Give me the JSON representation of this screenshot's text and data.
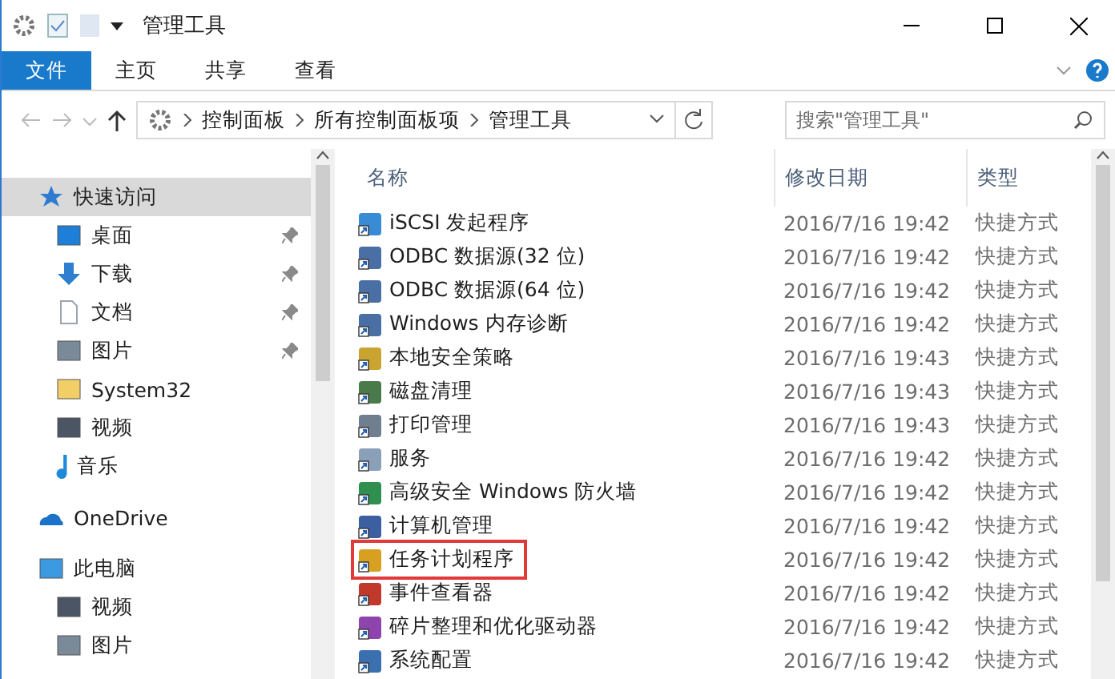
{
  "window": {
    "title": "管理工具"
  },
  "ribbon_tabs": [
    {
      "label": "文件",
      "selected": true
    },
    {
      "label": "主页",
      "selected": false
    },
    {
      "label": "共享",
      "selected": false
    },
    {
      "label": "查看",
      "selected": false
    }
  ],
  "address": {
    "segments": [
      "控制面板",
      "所有控制面板项",
      "管理工具"
    ]
  },
  "search": {
    "placeholder": "搜索\"管理工具\""
  },
  "sidebar": {
    "items": [
      {
        "label": "快速访问",
        "kind": "star",
        "selected": true,
        "pinned": false,
        "children": [
          {
            "label": "桌面",
            "kind": "desktop",
            "selected": false,
            "pinned": true
          },
          {
            "label": "下载",
            "kind": "download",
            "selected": false,
            "pinned": true
          },
          {
            "label": "文档",
            "kind": "document",
            "selected": false,
            "pinned": true
          },
          {
            "label": "图片",
            "kind": "picture",
            "selected": false,
            "pinned": true
          },
          {
            "label": "System32",
            "kind": "folder",
            "selected": false,
            "pinned": false
          },
          {
            "label": "视频",
            "kind": "video",
            "selected": false,
            "pinned": false
          },
          {
            "label": "音乐",
            "kind": "music",
            "selected": false,
            "pinned": false
          }
        ]
      },
      {
        "label": "OneDrive",
        "kind": "cloud",
        "selected": false,
        "pinned": false
      },
      {
        "label": "此电脑",
        "kind": "computer",
        "selected": false,
        "pinned": false,
        "children": [
          {
            "label": "视频",
            "kind": "video",
            "selected": false,
            "pinned": false
          },
          {
            "label": "图片",
            "kind": "picture",
            "selected": false,
            "pinned": false
          }
        ]
      }
    ]
  },
  "table": {
    "columns": [
      "名称",
      "修改日期",
      "类型"
    ],
    "rows": [
      {
        "name": "iSCSI 发起程序",
        "date": "2016/7/16 19:42",
        "type": "快捷方式",
        "highlighted": false
      },
      {
        "name": "ODBC 数据源(32 位)",
        "date": "2016/7/16 19:42",
        "type": "快捷方式",
        "highlighted": false
      },
      {
        "name": "ODBC 数据源(64 位)",
        "date": "2016/7/16 19:42",
        "type": "快捷方式",
        "highlighted": false
      },
      {
        "name": "Windows 内存诊断",
        "date": "2016/7/16 19:42",
        "type": "快捷方式",
        "highlighted": false
      },
      {
        "name": "本地安全策略",
        "date": "2016/7/16 19:43",
        "type": "快捷方式",
        "highlighted": false
      },
      {
        "name": "磁盘清理",
        "date": "2016/7/16 19:43",
        "type": "快捷方式",
        "highlighted": false
      },
      {
        "name": "打印管理",
        "date": "2016/7/16 19:43",
        "type": "快捷方式",
        "highlighted": false
      },
      {
        "name": "服务",
        "date": "2016/7/16 19:42",
        "type": "快捷方式",
        "highlighted": false
      },
      {
        "name": "高级安全 Windows 防火墙",
        "date": "2016/7/16 19:42",
        "type": "快捷方式",
        "highlighted": false
      },
      {
        "name": "计算机管理",
        "date": "2016/7/16 19:42",
        "type": "快捷方式",
        "highlighted": false
      },
      {
        "name": "任务计划程序",
        "date": "2016/7/16 19:42",
        "type": "快捷方式",
        "highlighted": true
      },
      {
        "name": "事件查看器",
        "date": "2016/7/16 19:42",
        "type": "快捷方式",
        "highlighted": false
      },
      {
        "name": "碎片整理和优化驱动器",
        "date": "2016/7/16 19:42",
        "type": "快捷方式",
        "highlighted": false
      },
      {
        "name": "系统配置",
        "date": "2016/7/16 19:42",
        "type": "快捷方式",
        "highlighted": false
      }
    ]
  }
}
